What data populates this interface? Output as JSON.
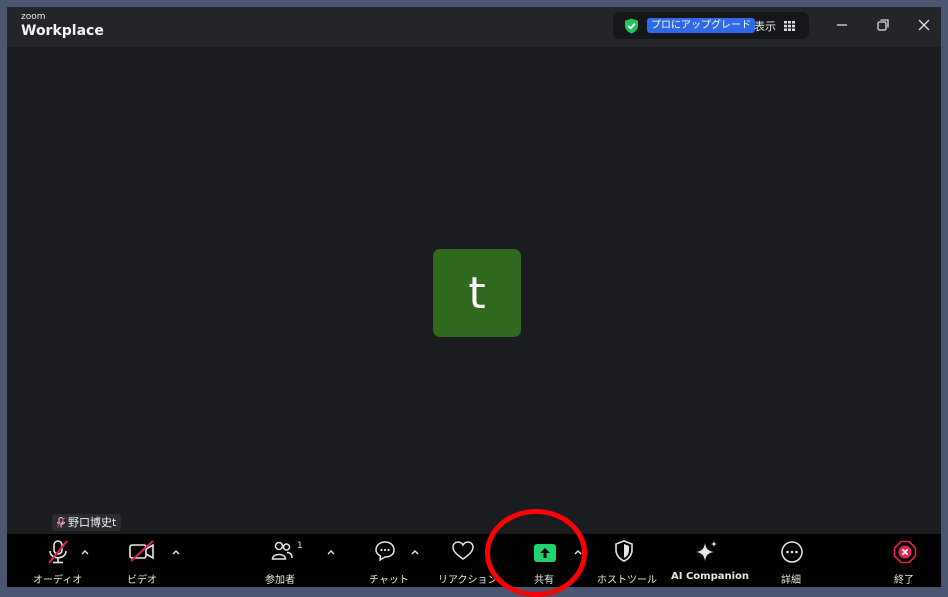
{
  "app": {
    "brand_small": "zoom",
    "brand_name": "Workplace"
  },
  "titlebar": {
    "upgrade_label": "プロにアップグレード",
    "view_label": "表示",
    "accent_color": "#2f6be8",
    "shield_color": "#23c25a"
  },
  "participant": {
    "avatar_initial": "t",
    "avatar_color": "#2f6a1e",
    "name": "野口博史t"
  },
  "toolbar": {
    "audio_label": "オーディオ",
    "video_label": "ビデオ",
    "participants_label": "参加者",
    "participants_count": "1",
    "chat_label": "チャット",
    "reactions_label": "リアクション",
    "share_label": "共有",
    "host_tools_label": "ホストツール",
    "ai_companion_label": "AI Companion",
    "more_label": "詳細",
    "end_label": "終了",
    "share_color": "#1fd36f",
    "end_color": "#e0244d"
  },
  "annotation": {
    "ring_color": "#ff0000"
  }
}
